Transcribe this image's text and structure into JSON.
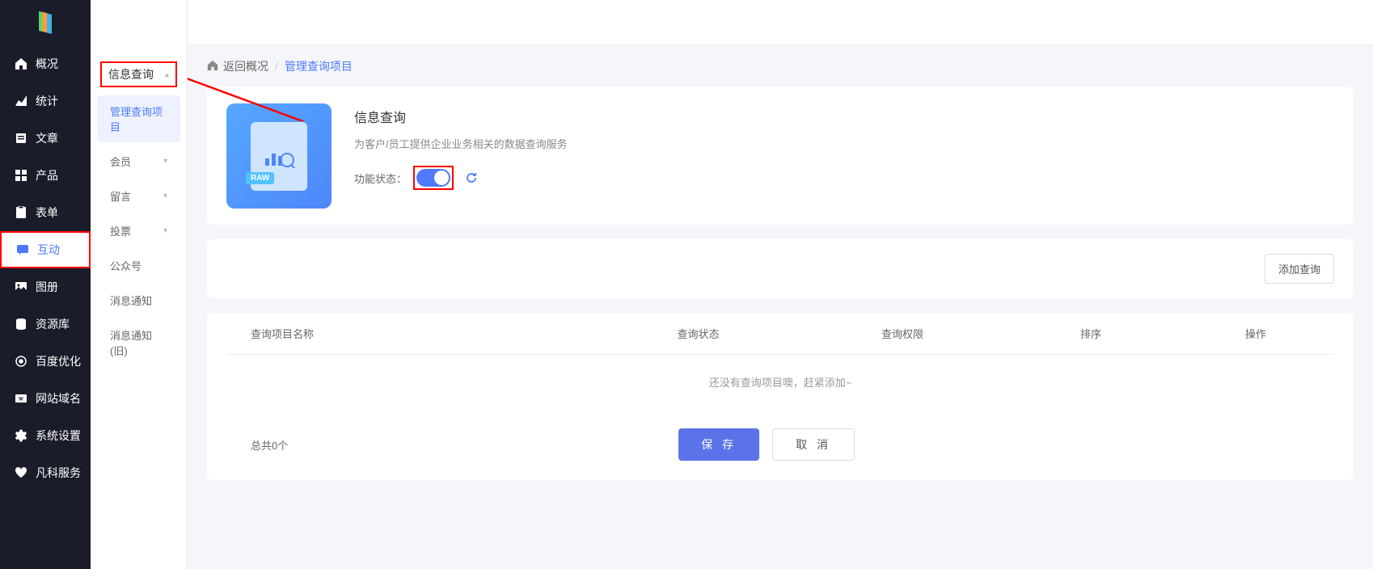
{
  "sidebar": {
    "items": [
      {
        "label": "概况",
        "icon": "home"
      },
      {
        "label": "统计",
        "icon": "chart"
      },
      {
        "label": "文章",
        "icon": "doc"
      },
      {
        "label": "产品",
        "icon": "grid"
      },
      {
        "label": "表单",
        "icon": "form"
      },
      {
        "label": "互动",
        "icon": "chat",
        "active": true
      },
      {
        "label": "图册",
        "icon": "image"
      },
      {
        "label": "资源库",
        "icon": "database"
      },
      {
        "label": "百度优化",
        "icon": "target"
      },
      {
        "label": "网站域名",
        "icon": "www"
      },
      {
        "label": "系统设置",
        "icon": "gear"
      },
      {
        "label": "凡科服务",
        "icon": "heart"
      }
    ]
  },
  "subSidebar": {
    "header": "信息查询",
    "items": [
      {
        "label": "管理查询项目",
        "selected": true
      },
      {
        "label": "会员",
        "expandable": true
      },
      {
        "label": "留言",
        "expandable": true
      },
      {
        "label": "投票",
        "expandable": true
      },
      {
        "label": "公众号"
      },
      {
        "label": "消息通知"
      },
      {
        "label": "消息通知(旧)"
      }
    ]
  },
  "breadcrumb": {
    "back": "返回概况",
    "current": "管理查询项目"
  },
  "info": {
    "title": "信息查询",
    "desc": "为客户/员工提供企业业务相关的数据查询服务",
    "statusLabel": "功能状态：",
    "docBadge": "RAW"
  },
  "actions": {
    "add": "添加查询"
  },
  "table": {
    "headers": [
      "查询项目名称",
      "查询状态",
      "查询权限",
      "排序",
      "操作"
    ],
    "empty": "还没有查询项目噢，赶紧添加~",
    "total": "总共0个"
  },
  "buttons": {
    "save": "保 存",
    "cancel": "取 消"
  }
}
